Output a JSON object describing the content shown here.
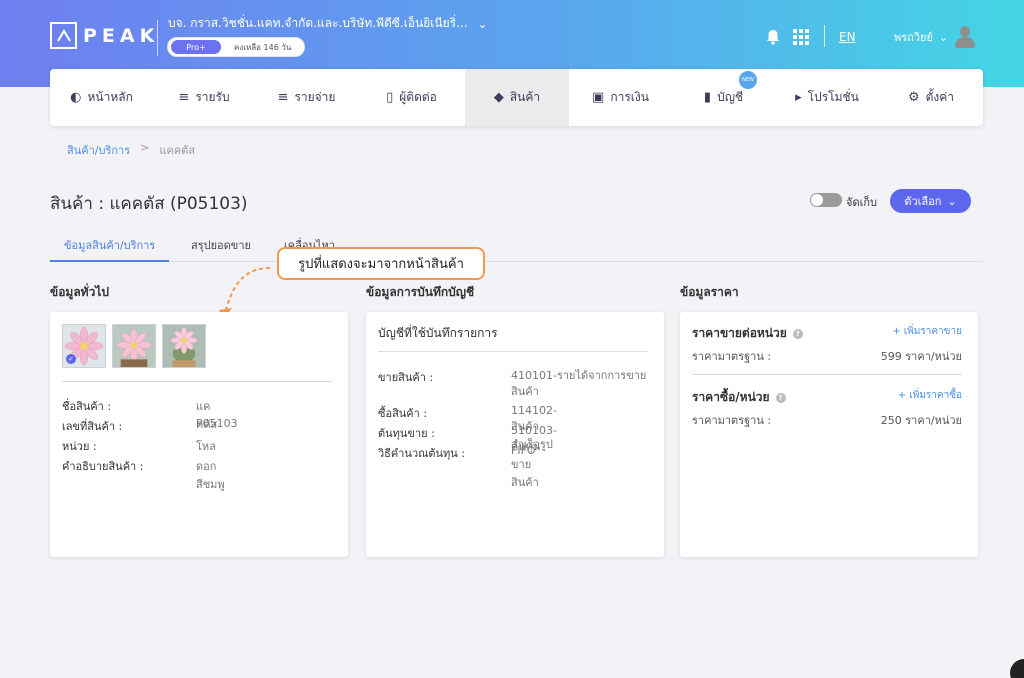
{
  "header": {
    "logo_text": "PEAK",
    "company_name": "บจ. กราส.วิชชั่น.แคท.จำกัด.และ.บริษัท.พีดีซี.เอ็นยิเนียริ่...",
    "plan_badge": "Pro+",
    "plan_remaining": "คงเหลือ 146 วัน",
    "language": "EN",
    "user_name": "พรถวิยย์"
  },
  "nav": {
    "items": [
      {
        "label": "หน้าหลัก",
        "icon": "dashboard-icon"
      },
      {
        "label": "รายรับ",
        "icon": "income-list-icon"
      },
      {
        "label": "รายจ่าย",
        "icon": "expense-list-icon"
      },
      {
        "label": "ผู้ติดต่อ",
        "icon": "contacts-icon"
      },
      {
        "label": "สินค้า",
        "icon": "product-box-icon"
      },
      {
        "label": "การเงิน",
        "icon": "money-icon"
      },
      {
        "label": "บัญชี",
        "icon": "ledger-icon"
      },
      {
        "label": "โปรโมชั่น",
        "icon": "megaphone-icon"
      },
      {
        "label": "ตั้งค่า",
        "icon": "settings-gear-icon"
      }
    ],
    "new_badge": "NEW"
  },
  "breadcrumb": {
    "parent": "สินค้า/บริการ",
    "separator": ">",
    "current": "แคคตัส"
  },
  "page": {
    "title": "สินค้า : แคคตัส (P05103)",
    "archive_label": "จัดเก็บ",
    "options_button": "ตัวเลือก"
  },
  "tabs": [
    {
      "label": "ข้อมูลสินค้า/บริการ",
      "active": true
    },
    {
      "label": "สรุปยอดขาย",
      "active": false
    },
    {
      "label": "เคลื่อนไหว",
      "active": false
    }
  ],
  "callout": {
    "text": "รูปที่แสดงจะมาจากหน้าสินค้า"
  },
  "general": {
    "section_title": "ข้อมูลทั่วไป",
    "fields": [
      {
        "label": "ชื่อสินค้า :",
        "value": "แคคตัส"
      },
      {
        "label": "เลขที่สินค้า :",
        "value": "P05103"
      },
      {
        "label": "หน่วย :",
        "value": "โหล"
      },
      {
        "label": "คำอธิบายสินค้า :",
        "value": "ดอกสีชมพู"
      }
    ]
  },
  "accounting": {
    "section_title": "ข้อมูลการบันทึกบัญชี",
    "card_title": "บัญชีที่ใช้บันทึกรายการ",
    "fields": [
      {
        "label": "ขายสินค้า :",
        "value": "410101-รายได้จากการขายสินค้า"
      },
      {
        "label": "ซื้อสินค้า :",
        "value": "114102-สินค้าสำเร็จรูป"
      },
      {
        "label": "ต้นทุนขาย :",
        "value": "510103-ต้นทุนขายสินค้า"
      },
      {
        "label": "วิธีคำนวณต้นทุน :",
        "value": "FIFO"
      }
    ]
  },
  "pricing": {
    "section_title": "ข้อมูลราคา",
    "sale": {
      "title": "ราคาขายต่อหน่วย",
      "add_label": "+ เพิ่มราคาขาย",
      "row_label": "ราคามาตรฐาน :",
      "row_value": "599 ราคา/หน่วย"
    },
    "purchase": {
      "title": "ราคาซื้อ/หน่วย",
      "add_label": "+ เพิ่มราคาซื้อ",
      "row_label": "ราคามาตรฐาน :",
      "row_value": "250 ราคา/หน่วย"
    }
  },
  "colors": {
    "accent": "#5c67ee",
    "link": "#4d8fe5",
    "callout_border": "#f39a4a"
  }
}
